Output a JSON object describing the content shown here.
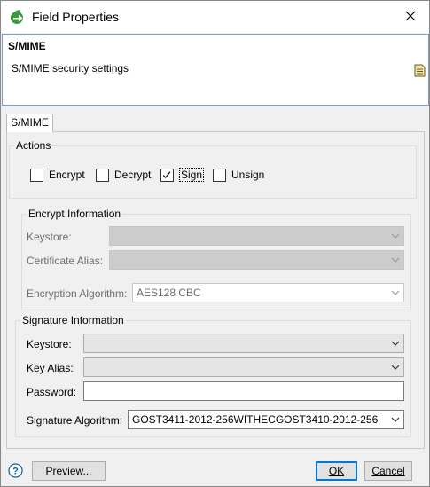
{
  "window": {
    "title": "Field Properties"
  },
  "header": {
    "title": "S/MIME",
    "description": "S/MIME security settings"
  },
  "tabs": [
    {
      "label": "S/MIME",
      "selected": true
    }
  ],
  "actions": {
    "legend": "Actions",
    "checkboxes": [
      {
        "label": "Encrypt",
        "checked": false
      },
      {
        "label": "Decrypt",
        "checked": false
      },
      {
        "label": "Sign",
        "checked": true
      },
      {
        "label": "Unsign",
        "checked": false
      }
    ]
  },
  "encrypt_info": {
    "legend": "Encrypt Information",
    "keystore_label": "Keystore:",
    "keystore_value": "",
    "alias_label": "Certificate Alias:",
    "alias_value": "",
    "algorithm_label": "Encryption Algorithm:",
    "algorithm_value": "AES128 CBC"
  },
  "signature_info": {
    "legend": "Signature Information",
    "keystore_label": "Keystore:",
    "keystore_value": "",
    "alias_label": "Key Alias:",
    "alias_value": "",
    "password_label": "Password:",
    "password_value": "",
    "algorithm_label": "Signature Algorithm:",
    "algorithm_value": "GOST3411-2012-256WITHECGOST3410-2012-256"
  },
  "buttons": {
    "preview": "Preview...",
    "ok": "OK",
    "cancel": "Cancel"
  },
  "colors": {
    "accent": "#0078d7",
    "header_border": "#7a9cd3",
    "icon_green": "#3c9a3c"
  }
}
